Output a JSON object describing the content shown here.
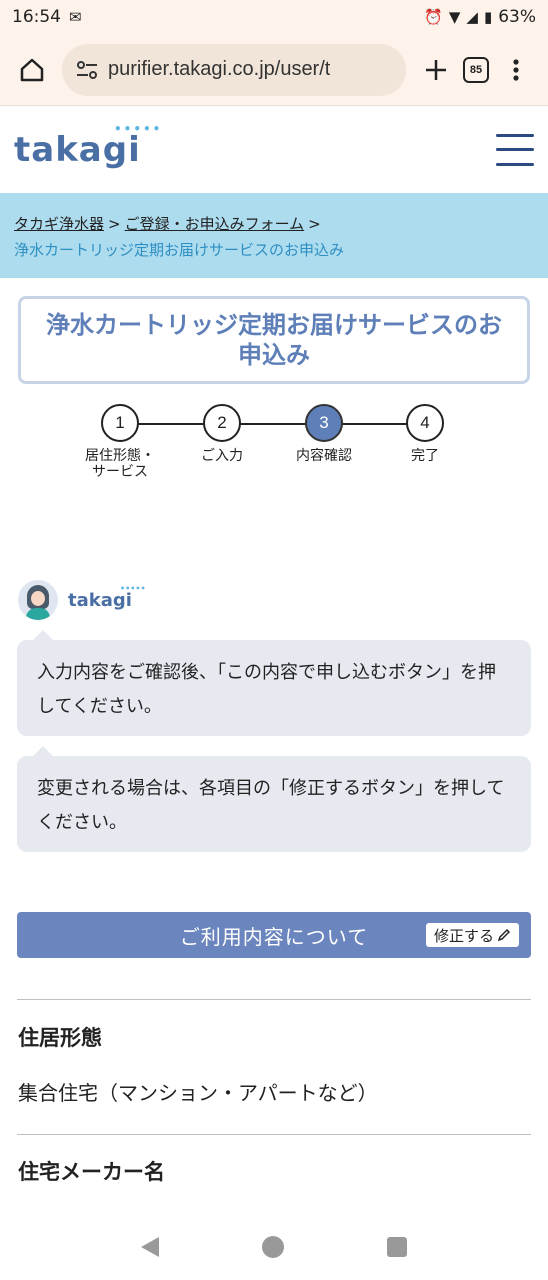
{
  "status": {
    "time": "16:54",
    "battery": "63%"
  },
  "browser": {
    "url": "purifier.takagi.co.jp/user/t",
    "tab_count": "85"
  },
  "site": {
    "logo": "takagi",
    "logo_dots": "•••••"
  },
  "breadcrumb": {
    "items": [
      "タカギ浄水器",
      "ご登録・お申込みフォーム"
    ],
    "separator": ">",
    "current": "浄水カートリッジ定期お届けサービスのお申込み"
  },
  "page": {
    "title": "浄水カートリッジ定期お届けサービスのお申込み"
  },
  "stepper": {
    "steps": [
      {
        "number": "1",
        "label": "居住形態・サービス"
      },
      {
        "number": "2",
        "label": "ご入力"
      },
      {
        "number": "3",
        "label": "内容確認"
      },
      {
        "number": "4",
        "label": "完了"
      }
    ],
    "active_step": 3
  },
  "chat": {
    "brand": "takagi",
    "messages": [
      "入力内容をご確認後、「この内容で申し込むボタン」を押してください。",
      "変更される場合は、各項目の「修正するボタン」を押してください。"
    ]
  },
  "section": {
    "title": "ご利用内容について",
    "edit_label": "修正する"
  },
  "fields": [
    {
      "label": "住居形態",
      "value": "集合住宅（マンション・アパートなど）"
    },
    {
      "label": "住宅メーカー名",
      "value": ""
    }
  ]
}
